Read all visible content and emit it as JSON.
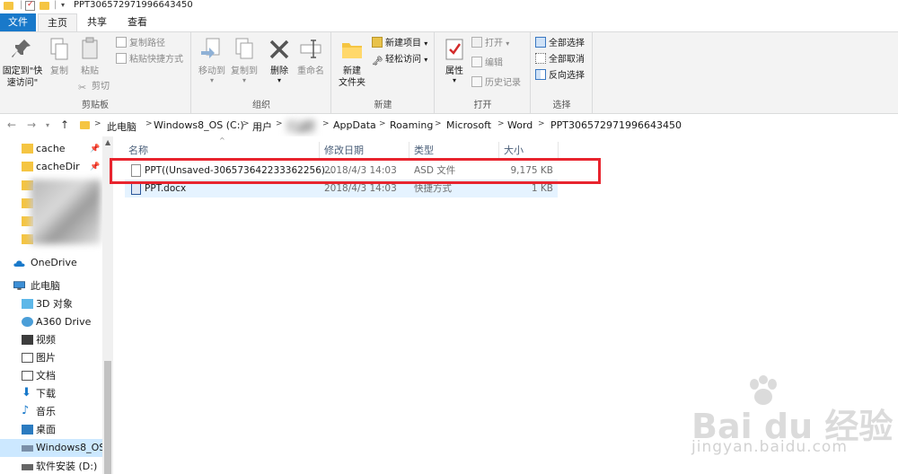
{
  "window": {
    "title": "PPT306572971996643450"
  },
  "ribbon_tabs": {
    "file": "文件",
    "home": "主页",
    "share": "共享",
    "view": "查看"
  },
  "ribbon": {
    "clipboard": {
      "label": "剪贴板",
      "pin_quick_access": "固定到\"快",
      "pin_quick_access_2": "速访问\"",
      "copy": "复制",
      "paste": "粘贴",
      "copy_path": "复制路径",
      "paste_shortcut": "粘贴快捷方式",
      "cut": "剪切"
    },
    "organize": {
      "label": "组织",
      "move_to": "移动到",
      "copy_to": "复制到",
      "delete": "删除",
      "rename": "重命名"
    },
    "new": {
      "label": "新建",
      "new_folder": "新建",
      "new_folder_2": "文件夹",
      "new_item": "新建项目",
      "easy_access": "轻松访问"
    },
    "open": {
      "label": "打开",
      "properties": "属性",
      "open": "打开",
      "edit": "编辑",
      "history": "历史记录"
    },
    "select": {
      "label": "选择",
      "select_all": "全部选择",
      "select_none": "全部取消",
      "invert": "反向选择"
    }
  },
  "breadcrumb": [
    "此电脑",
    "Windows8_OS (C:)",
    "用户",
    "",
    "AppData",
    "Roaming",
    "Microsoft",
    "Word",
    "PPT306572971996643450"
  ],
  "nav": {
    "quick": [
      {
        "label": "cache"
      },
      {
        "label": "cacheDir"
      }
    ],
    "onedrive": "OneDrive",
    "this_pc": "此电脑",
    "pc_items": [
      "3D 对象",
      "A360 Drive",
      "视频",
      "图片",
      "文档",
      "下载",
      "音乐",
      "桌面",
      "Windows8_OS",
      "软件安装 (D:)"
    ]
  },
  "columns": {
    "name": "名称",
    "date": "修改日期",
    "type": "类型",
    "size": "大小"
  },
  "files": [
    {
      "name": "PPT((Unsaved-306573642233362256)...",
      "date": "2018/4/3 14:03",
      "type": "ASD 文件",
      "size": "9,175 KB"
    },
    {
      "name": "PPT.docx",
      "date": "2018/4/3 14:03",
      "type": "快捷方式",
      "size": "1 KB"
    }
  ],
  "watermark": {
    "logo": "Bai du 经验",
    "url": "jingyan.baidu.com"
  },
  "colors": {
    "file_tab": "#1979ca",
    "highlight_box": "#e8242e",
    "selected_nav": "#cce8ff",
    "hover_row": "#e5f3ff"
  }
}
